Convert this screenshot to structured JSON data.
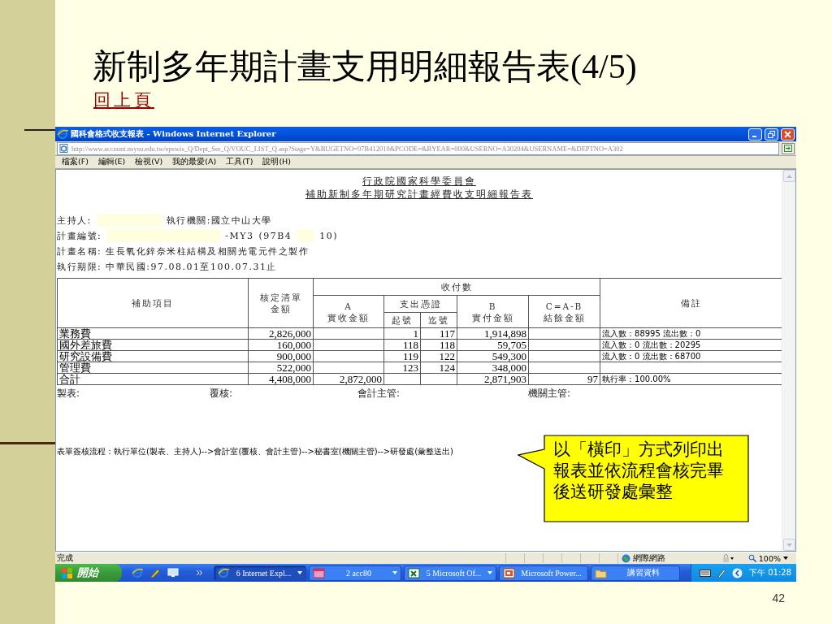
{
  "slide": {
    "title": "新制多年期計畫支用明細報告表(4/5)",
    "back_link": "回上頁",
    "page_number": "42"
  },
  "browser": {
    "window_title": "國科會格式收支報表 - Windows Internet Explorer",
    "address": "http://www.account.nsysu.edu.tw/epswis_Q/Dept_Ser_Q/VOUC_LIST_Q.asp?Stage=Y&BUGETNO=97B412010&PCODE=&BYEAR=000&USERNO=A30204&USERNAME=&DEPTNO=A302",
    "menu": [
      "檔案(F)",
      "編輯(E)",
      "檢視(V)",
      "我的最愛(A)",
      "工具(T)",
      "說明(H)"
    ],
    "status": "完成",
    "zone": "網際網路",
    "zoom": "100%"
  },
  "report": {
    "org_title": "行政院國家科學委員會",
    "report_title": "補助新制多年期研究計畫經費收支明細報告表",
    "fields": [
      [
        {
          "kind": "text",
          "text": "主持人:"
        },
        {
          "kind": "blank",
          "wide": false
        },
        {
          "kind": "text",
          "text": "執行機關:國立中山大學"
        }
      ],
      [
        {
          "kind": "text",
          "text": "計畫編號:"
        },
        {
          "kind": "blank",
          "wide": true
        },
        {
          "kind": "text",
          "text": "-MY3"
        },
        {
          "kind": "text",
          "text": "(97B4"
        },
        {
          "kind": "blank",
          "wide": false
        },
        {
          "kind": "text",
          "text": "10)"
        }
      ],
      [
        {
          "kind": "text",
          "text": "計畫名稱: 生長氧化鋅奈米柱結構及相關光電元件之製作"
        }
      ],
      [
        {
          "kind": "text",
          "text": "執行期限: 中華民國:97.08.01至100.07.31止"
        }
      ]
    ],
    "header": {
      "item": [
        "補助項目"
      ],
      "approved": [
        "核定清單",
        "金額"
      ],
      "group": [
        "收付數"
      ],
      "received": [
        "A",
        "實收金額"
      ],
      "voucher": [
        "支出憑證"
      ],
      "start": [
        "起號"
      ],
      "end": [
        "迄號"
      ],
      "paid": [
        "B",
        "實付金額"
      ],
      "balance": [
        "C=A-B",
        "結餘金額"
      ],
      "note": [
        "備註"
      ]
    },
    "rows": [
      {
        "item": "業務費",
        "approved": "2,826,000",
        "start": "1",
        "end": "117",
        "paid": "1,914,898",
        "note": "流入數：88995 流出數：0"
      },
      {
        "item": "國外差旅費",
        "approved": "160,000",
        "start": "118",
        "end": "118",
        "paid": "59,705",
        "note": "流入數：0 流出數：20295"
      },
      {
        "item": "研究設備費",
        "approved": "900,000",
        "start": "119",
        "end": "122",
        "paid": "549,300",
        "note": "流入數：0 流出數：68700"
      },
      {
        "item": "管理費",
        "approved": "522,000",
        "start": "123",
        "end": "124",
        "paid": "348,000"
      },
      {
        "item": "合計",
        "approved": "4,408,000",
        "received": "2,872,000",
        "paid": "2,871,903",
        "balance": "97",
        "note": "執行率：100.00%"
      }
    ],
    "signatures": [
      "製表:",
      "覆核:",
      "會計主管:",
      "機關主管:"
    ],
    "flow_note": "表單簽核流程：執行單位(製表、主持人)-->會計室(覆核、會計主管)-->秘書室(機關主管)-->研發處(彙整送出)"
  },
  "taskbar": {
    "start": "開始",
    "tasks": [
      {
        "kind": "ie",
        "label": "6 Internet Expl...",
        "selected": true,
        "grouped": true
      },
      {
        "kind": "acc",
        "label": "2 acc80",
        "selected": false,
        "grouped": true
      },
      {
        "kind": "excel",
        "label": "5 Microsoft Of...",
        "selected": false,
        "grouped": true
      },
      {
        "kind": "powerpoint",
        "label": "Microsoft Power...",
        "selected": false,
        "grouped": false
      },
      {
        "kind": "folder",
        "label": "講習資料",
        "selected": false,
        "grouped": false
      }
    ],
    "clock": "下午 01:28"
  },
  "callout": {
    "text": "以「橫印」方式列印出報表並依流程會核完畢後送研發處彙整"
  }
}
